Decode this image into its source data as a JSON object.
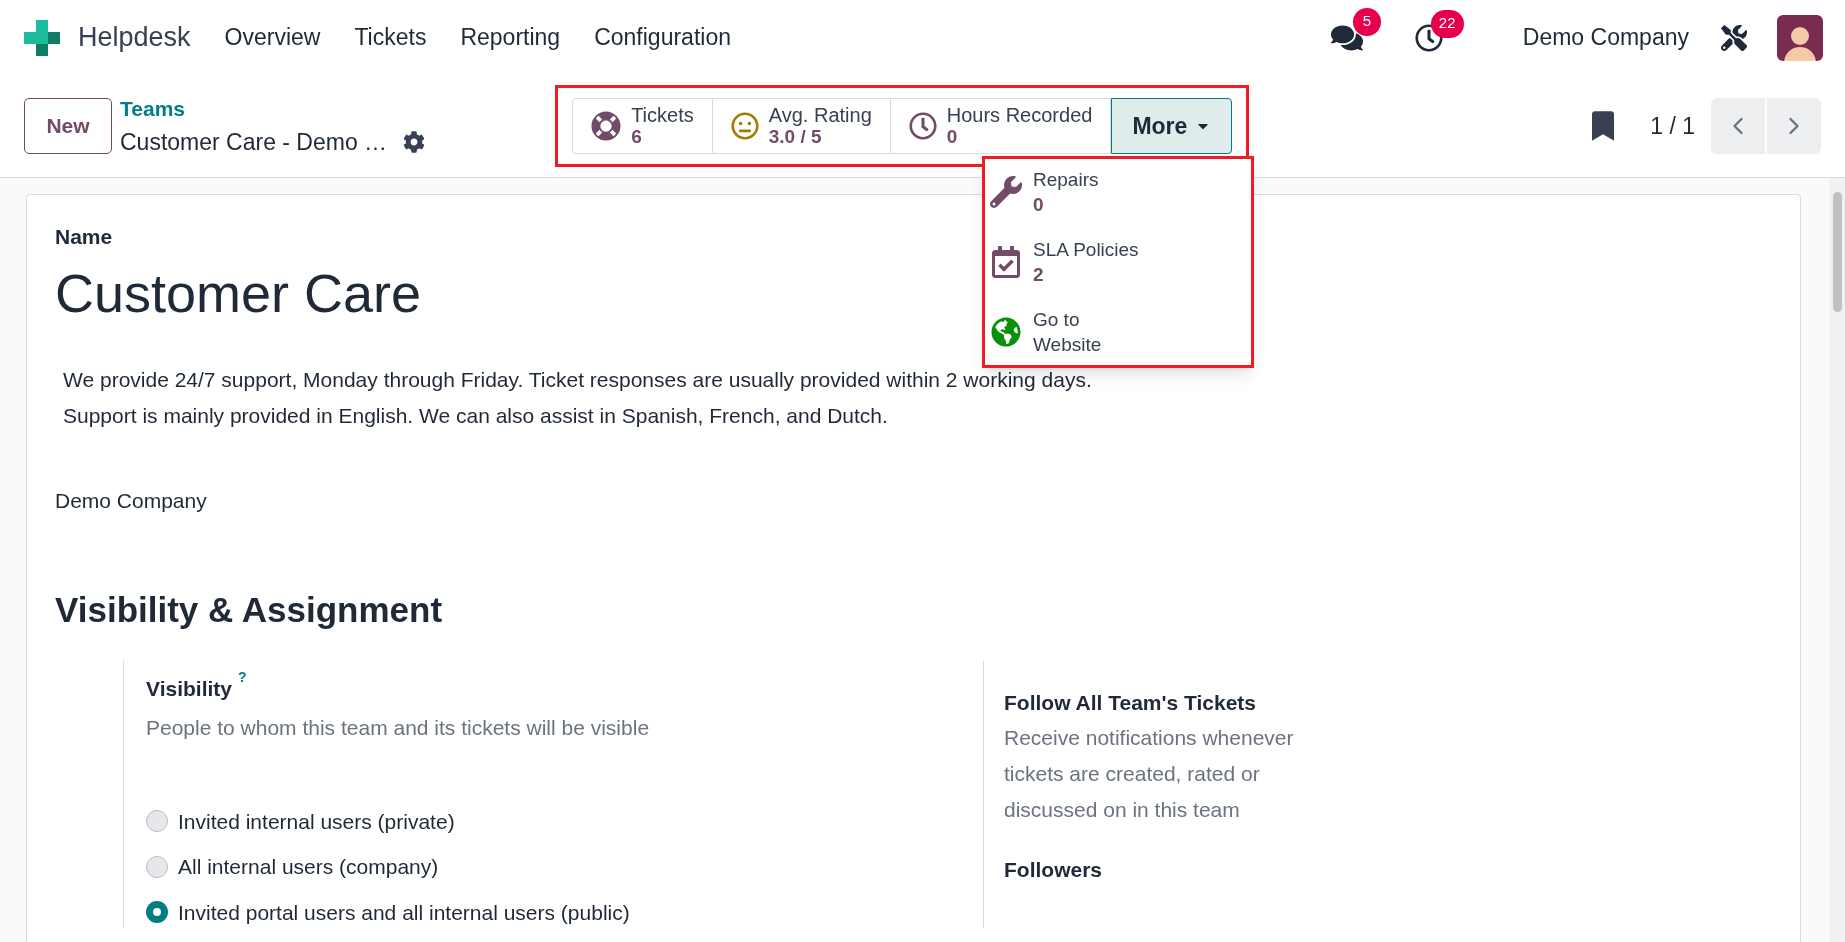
{
  "navbar": {
    "app_name": "Helpdesk",
    "menu": [
      "Overview",
      "Tickets",
      "Reporting",
      "Configuration"
    ],
    "messages_badge": "5",
    "activities_badge": "22",
    "company": "Demo Company"
  },
  "control_panel": {
    "new_button": "New",
    "breadcrumb": "Teams",
    "record_title": "Customer Care - Demo …",
    "stat_buttons": [
      {
        "kind": "tickets",
        "label": "Tickets",
        "value": "6"
      },
      {
        "kind": "rating",
        "label": "Avg. Rating",
        "value": "3.0 / 5"
      },
      {
        "kind": "hours",
        "label": "Hours Recorded",
        "value": "0"
      }
    ],
    "more_button": "More",
    "more_menu": [
      {
        "kind": "repairs",
        "label": "Repairs",
        "value": "0"
      },
      {
        "kind": "sla",
        "label": "SLA Policies",
        "value": "2"
      },
      {
        "kind": "website",
        "label": "Go to Website"
      }
    ],
    "pager": "1 / 1"
  },
  "form": {
    "name_label": "Name",
    "name": "Customer Care",
    "description_lines": [
      "We provide 24/7 support, Monday through Friday. Ticket responses are usually provided within 2 working days.",
      "Support is mainly provided in English. We can also assist in Spanish, French, and Dutch."
    ],
    "company": "Demo Company",
    "section_title": "Visibility & Assignment",
    "visibility": {
      "label": "Visibility",
      "help": "?",
      "description": "People to whom this team and its tickets will be visible",
      "options": [
        {
          "label": "Invited internal users (private)",
          "selected": false
        },
        {
          "label": "All internal users (company)",
          "selected": false
        },
        {
          "label": "Invited portal users and all internal users (public)",
          "selected": true
        }
      ]
    },
    "follow": {
      "label": "Follow All Team's Tickets",
      "description": "Receive notifications whenever tickets are created, rated or discussed on in this team"
    },
    "followers_label": "Followers"
  }
}
